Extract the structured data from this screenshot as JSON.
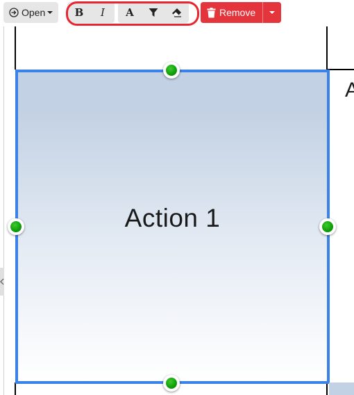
{
  "toolbar": {
    "open_label": "Open",
    "bold_label": "B",
    "italic_label": "I",
    "font_color_label": "A",
    "remove_label": "Remove"
  },
  "canvas": {
    "selected_shape_label": "Action 1",
    "neighbor_shape_label": "A"
  },
  "colors": {
    "selection_border": "#3a82e8",
    "handle": "#11a10b",
    "remove_button": "#e4353c",
    "highlight": "#e8242f"
  }
}
